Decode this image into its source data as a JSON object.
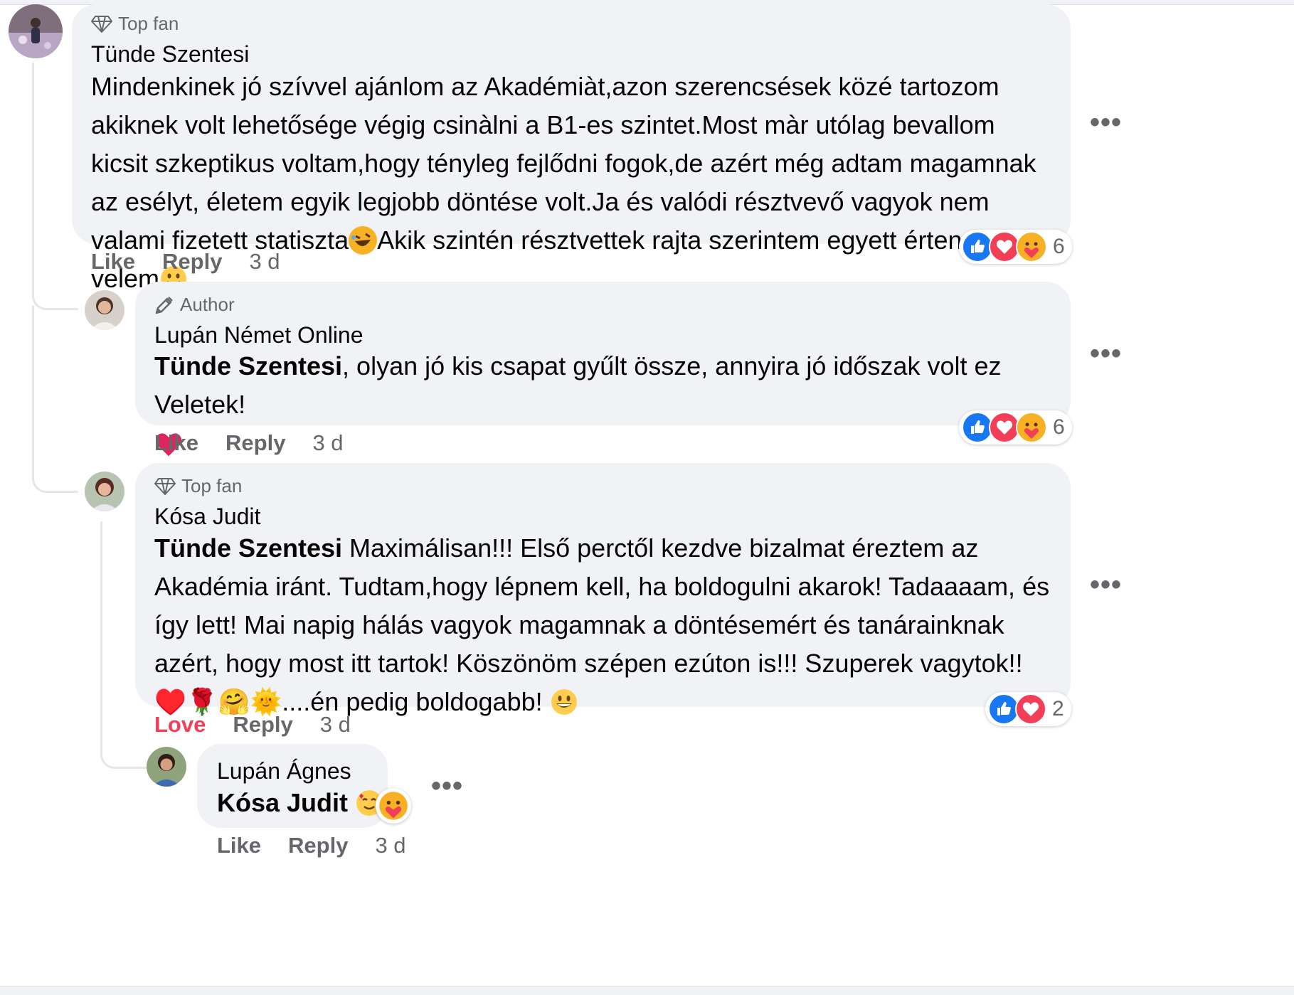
{
  "comments": [
    {
      "badge": "Top fan",
      "author": "Tünde Szentesi",
      "text": "Mindenkinek jó szívvel ajánlom az Akadémiàt,azon szerencsések közé tartozom akiknek volt lehetősége végig csinàlni a B1-es szintet.Most màr utólag bevallom kicsit szkeptikus voltam,hogy tényleg fejlődni fogok,de azért még adtam magamnak az esélyt, életem egyik legjobb döntése volt.Ja és valódi résztvevő vagyok nem valami fizetett statiszta",
      "text_after_emoji": "Akik szintén résztvettek rajta szerintem egyett értenek velem",
      "action_like": "Like",
      "action_reply": "Reply",
      "time": "3 d",
      "reaction_count": "6",
      "more": "•••"
    },
    {
      "badge": "Author",
      "author": "Lupán Német Online",
      "mention": "Tünde Szentesi",
      "text": ", olyan jó kis csapat gyűlt össze, annyira jó időszak volt ez Veletek!",
      "emoji_end": "❤️",
      "action_like": "Like",
      "action_reply": "Reply",
      "time": "3 d",
      "reaction_count": "6",
      "more": "•••"
    },
    {
      "badge": "Top fan",
      "author": "Kósa Judit",
      "mention": "Tünde Szentesi",
      "text": " Maximálisan!!! Első perctől kezdve bizalmat éreztem az Akadémia iránt. Tudtam,hogy lépnem kell, ha boldogulni akarok! Tadaaaam, és így lett! Mai napig hálás vagyok magamnak a döntésemért és tanárainknak azért, hogy most itt tartok! Köszönöm szépen ezúton is!!! Szuperek vagytok!! ",
      "emojis_mid": "♥️🌹🤗🌞",
      "text_tail": "....én pedig boldogabb! ",
      "emoji_end": "😀",
      "action_love": "Love",
      "action_reply": "Reply",
      "time": "3 d",
      "reaction_count": "2",
      "more": "•••"
    },
    {
      "author": "Lupán Ágnes",
      "mention": "Kósa Judit",
      "emoji_end": "🥰",
      "action_like": "Like",
      "action_reply": "Reply",
      "time": "3 d",
      "more": "•••"
    }
  ],
  "colors": {
    "bubble": "#f0f2f5",
    "like_blue": "#1877f2",
    "love_red": "#f33e58",
    "secondary_text": "#65676b"
  }
}
